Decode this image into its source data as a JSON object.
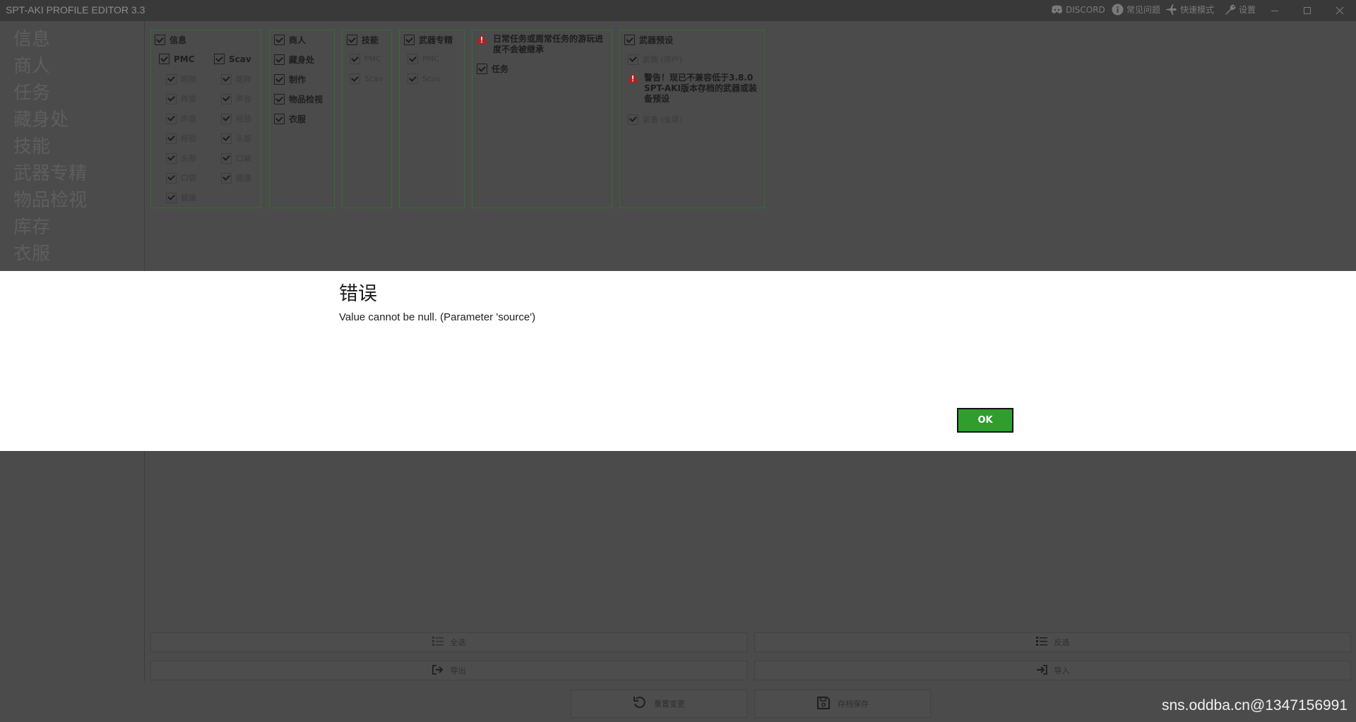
{
  "app": {
    "title": "SPT-AKI PROFILE EDITOR  3.3"
  },
  "titlebar": {
    "discord": "DISCORD",
    "faq": "常见问题",
    "fast_mode": "快速模式",
    "settings": "设置"
  },
  "sidebar": {
    "items": [
      "信息",
      "商人",
      "任务",
      "藏身处",
      "技能",
      "武器专精",
      "物品检视",
      "库存",
      "衣服"
    ]
  },
  "groups": {
    "info": {
      "label": "信息",
      "pmc": "PMC",
      "scav": "Scav",
      "pmc_items": [
        "昵称",
        "阵营",
        "声音",
        "经验",
        "头部",
        "口袋",
        "健康"
      ],
      "scav_items": [
        "昵称",
        "声音",
        "经验",
        "头部",
        "口袋",
        "健康"
      ]
    },
    "traders": {
      "items": [
        "商人",
        "藏身处",
        "制作",
        "物品检视",
        "衣服"
      ]
    },
    "skills": {
      "label": "技能",
      "pmc": "PMC",
      "scav": "Scav"
    },
    "mastering": {
      "label": "武器专精",
      "pmc": "PMC",
      "scav": "Scav"
    },
    "quests": {
      "warning": "日常任务或周常任务的游玩进度不会被继承",
      "label": "任务"
    },
    "presets": {
      "label": "武器预设",
      "weapons_user": "武器 (用户)",
      "warning": "警告！现已不兼容低于3.8.0 SPT-AKI版本存档的武器或装备预设",
      "equipment_global": "装备 (全局)"
    }
  },
  "buttons": {
    "select_all": "全选",
    "invert": "反选",
    "export": "导出",
    "import": "导入",
    "reset": "重置变更",
    "save": "存档保存"
  },
  "dialog": {
    "title": "错误",
    "message": "Value cannot be null. (Parameter 'source')",
    "ok": "OK"
  },
  "watermark": "sns.oddba.cn@1347156991",
  "colors": {
    "accent_green": "#2f9e2f",
    "group_border": "#336d33",
    "warning_red": "#b02020",
    "overlay": "#4b4b4b"
  }
}
